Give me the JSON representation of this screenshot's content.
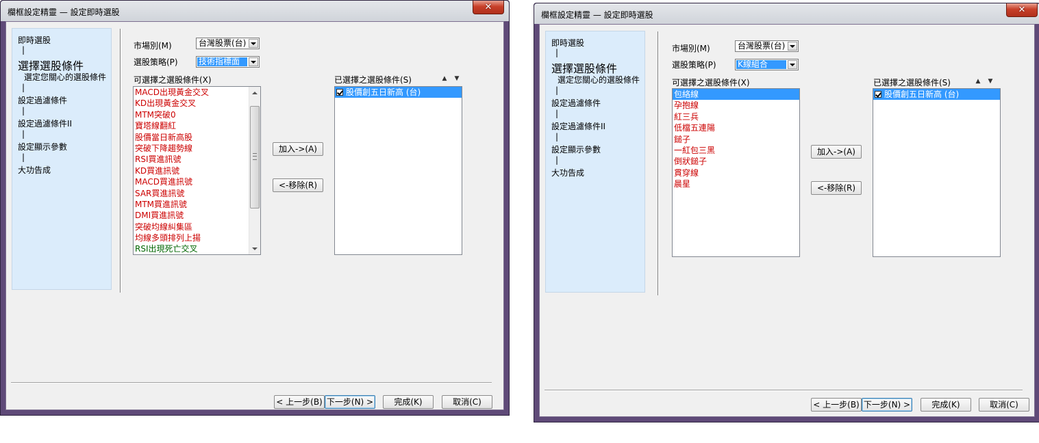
{
  "windows": [
    {
      "title": "欄框設定精靈 — 設定即時選股",
      "steps": {
        "s1": "即時選股",
        "sep1": "|",
        "s2": "選擇選股條件",
        "s2_sub": "選定您關心的選股條件",
        "sep2": "|",
        "s3": "設定過濾條件",
        "sep3": "|",
        "s4": "設定過濾條件II",
        "sep4": "|",
        "s5": "設定顯示參數",
        "sep5": "|",
        "s6": "大功告成"
      },
      "market_label": "市場別(M)",
      "market_value": "台灣股票(台)",
      "strategy_label": "選股策略(P)",
      "strategy_value": "技術指標面",
      "available_label": "可選擇之選股條件(X)",
      "selected_label": "已選擇之選股條件(S)",
      "available_items": [
        {
          "text": "MACD出現黃金交叉",
          "color": "#cc0000"
        },
        {
          "text": "KD出現黃金交叉",
          "color": "#cc0000"
        },
        {
          "text": "MTM突破0",
          "color": "#cc0000"
        },
        {
          "text": "寶塔線翻紅",
          "color": "#cc0000"
        },
        {
          "text": "股價當日新高股",
          "color": "#cc0000"
        },
        {
          "text": "突破下降趨勢線",
          "color": "#cc0000"
        },
        {
          "text": "RSI買進訊號",
          "color": "#cc0000"
        },
        {
          "text": "KD買進訊號",
          "color": "#cc0000"
        },
        {
          "text": "MACD買進訊號",
          "color": "#cc0000"
        },
        {
          "text": "SAR買進訊號",
          "color": "#cc0000"
        },
        {
          "text": "MTM買進訊號",
          "color": "#cc0000"
        },
        {
          "text": "DMI買進訊號",
          "color": "#cc0000"
        },
        {
          "text": "突破均線糾集區",
          "color": "#cc0000"
        },
        {
          "text": "均線多頭排列上揚",
          "color": "#cc0000"
        },
        {
          "text": "RSI出現死亡交叉",
          "color": "#006600"
        }
      ],
      "selected_items": [
        "股價創五日新高 (台)"
      ],
      "btn_add": "加入->(A)",
      "btn_remove": "<-移除(R)",
      "btn_back": "< 上一步(B)",
      "btn_next": "下一步(N) >",
      "btn_finish": "完成(K)",
      "btn_cancel": "取消(C)"
    },
    {
      "title": "欄框設定精靈 — 設定即時選股",
      "steps": {
        "s1": "即時選股",
        "sep1": "|",
        "s2": "選擇選股條件",
        "s2_sub": "選定您關心的選股條件",
        "sep2": "|",
        "s3": "設定過濾條件",
        "sep3": "|",
        "s4": "設定過濾條件II",
        "sep4": "|",
        "s5": "設定顯示參數",
        "sep5": "|",
        "s6": "大功告成"
      },
      "market_label": "市場別(M)",
      "market_value": "台灣股票(台)",
      "strategy_label": "選股策略(P)",
      "strategy_value": "K線組合",
      "available_label": "可選擇之選股條件(X)",
      "selected_label": "已選擇之選股條件(S)",
      "available_items": [
        {
          "text": "包絡線",
          "color": "#cc0000"
        },
        {
          "text": "孕抱線",
          "color": "#cc0000"
        },
        {
          "text": "紅三兵",
          "color": "#cc0000"
        },
        {
          "text": "低檔五連陽",
          "color": "#cc0000"
        },
        {
          "text": "鎚子",
          "color": "#cc0000"
        },
        {
          "text": "一紅包三黑",
          "color": "#cc0000"
        },
        {
          "text": "倒狀鎚子",
          "color": "#cc0000"
        },
        {
          "text": "貫穿線",
          "color": "#cc0000"
        },
        {
          "text": "晨星",
          "color": "#cc0000"
        }
      ],
      "selected_items": [
        "股價創五日新高 (台)"
      ],
      "btn_add": "加入->(A)",
      "btn_remove": "<-移除(R)",
      "btn_back": "< 上一步(B)",
      "btn_next": "下一步(N) >",
      "btn_finish": "完成(K)",
      "btn_cancel": "取消(C)"
    }
  ],
  "icons": {
    "close": "close-icon",
    "move_up": "arrow-up-icon",
    "move_down": "arrow-down-icon"
  },
  "colors": {
    "frame": "#5f4a78",
    "close_button": "#c8402a",
    "selection": "#3399ff",
    "step_panel": "#dbecfb",
    "condition_red": "#cc0000",
    "condition_green": "#006600"
  }
}
